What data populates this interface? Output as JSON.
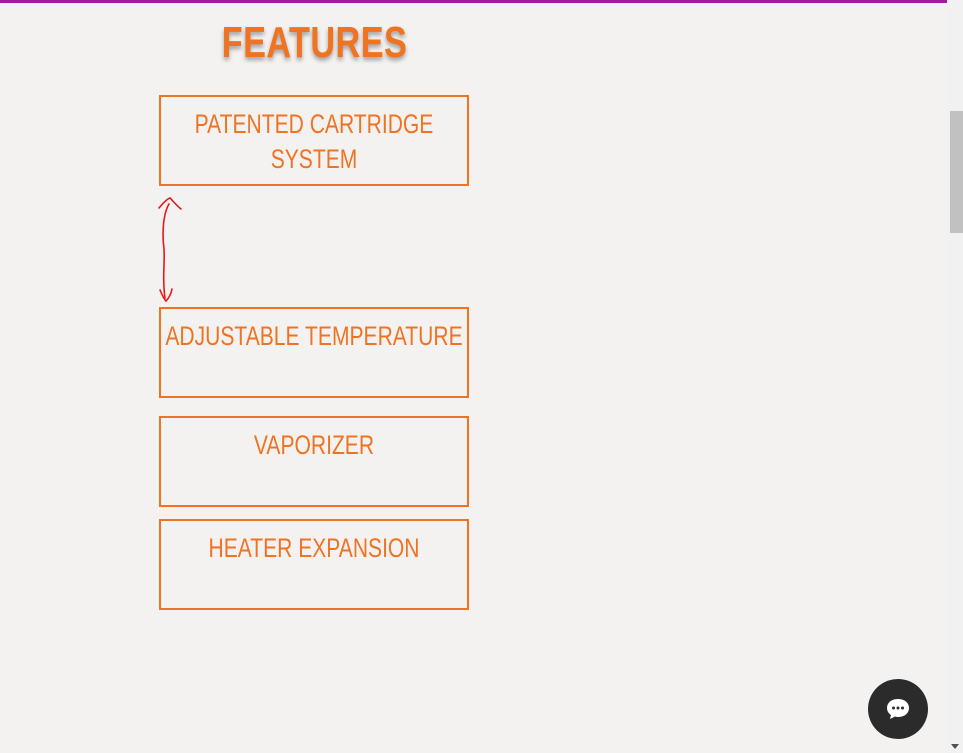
{
  "features": {
    "heading": "FEATURES",
    "items": [
      {
        "label": "PATENTED CARTRIDGE SYSTEM"
      },
      {
        "label": "ADJUSTABLE TEMPERATURE"
      },
      {
        "label": "VAPORIZER"
      },
      {
        "label": "HEATER EXPANSION"
      }
    ]
  },
  "colors": {
    "accent": "#f07322",
    "top_border": "#9b1f9c",
    "background": "#f4f1f1",
    "annotation": "#e81818",
    "chat_button": "#2b2b2b"
  },
  "icons": {
    "annotation": "double-headed-arrow-icon",
    "chat": "chat-bubble-icon",
    "scroll_down": "chevron-down-icon"
  }
}
